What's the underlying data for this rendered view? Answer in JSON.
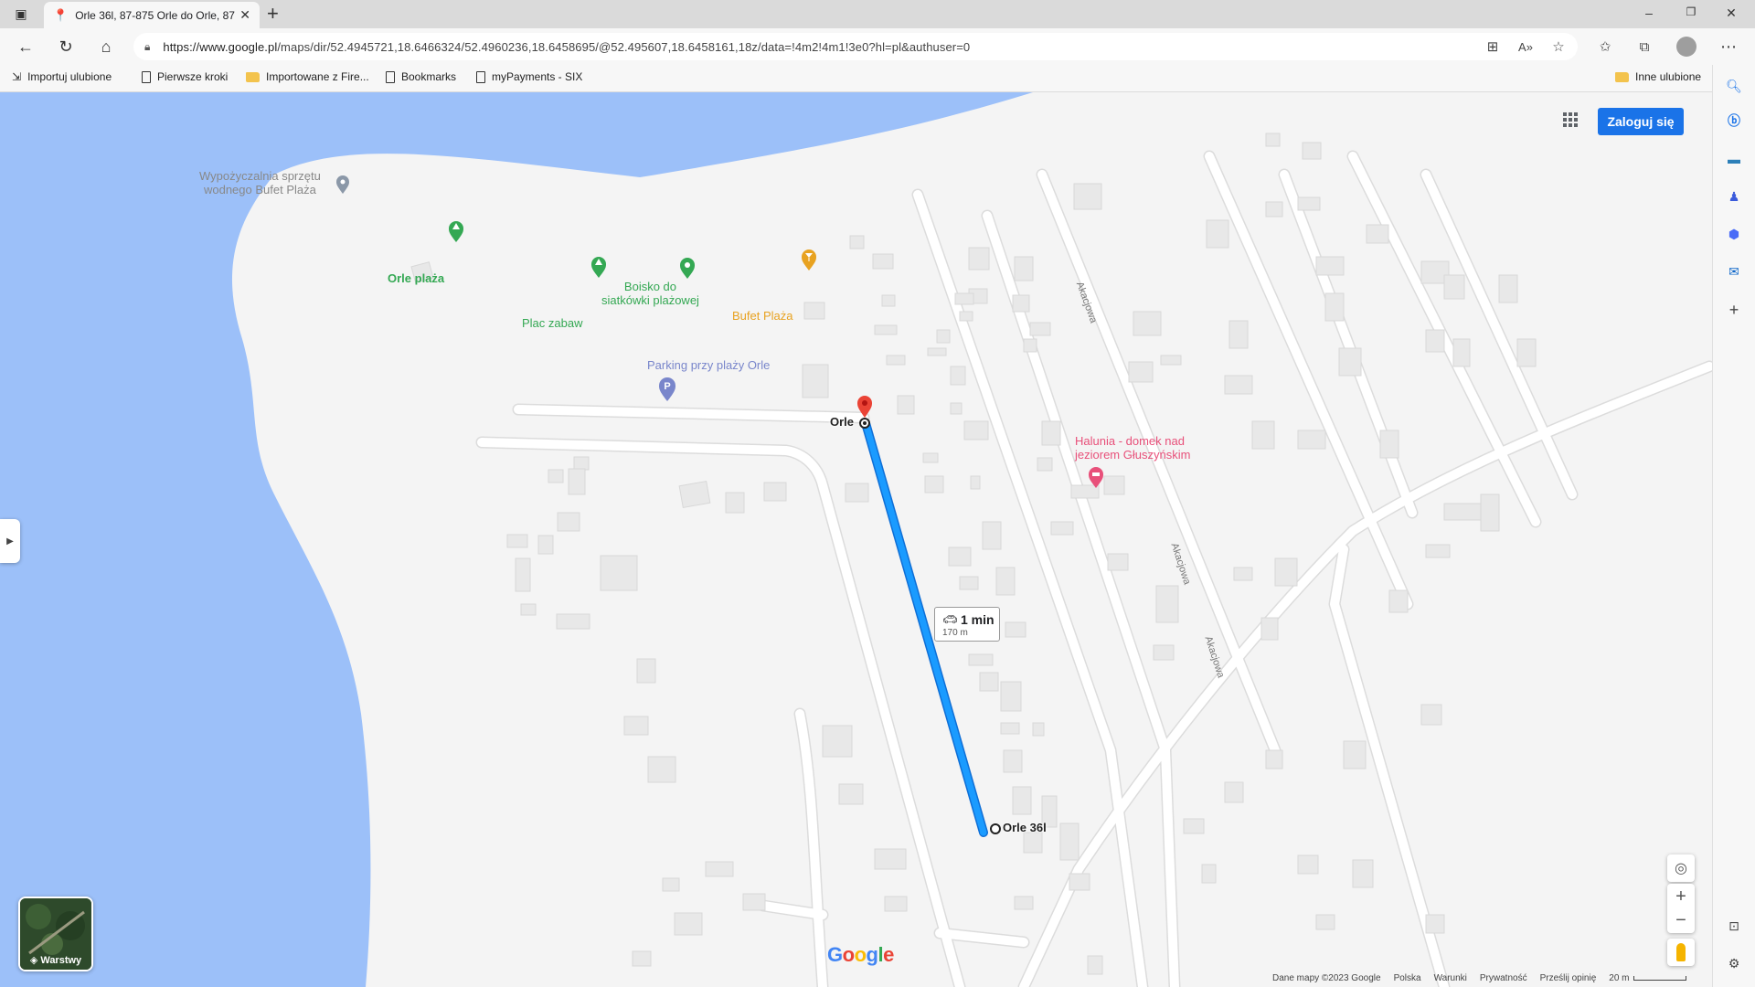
{
  "browser": {
    "tab_title": "Orle 36l, 87-875 Orle do Orle, 87",
    "url_host": "https://www.google.pl",
    "url_path": "/maps/dir/52.4945721,18.6466324/52.4960236,18.6458695/@52.495607,18.6458161,18z/data=!4m2!4m1!3e0?hl=pl&authuser=0"
  },
  "favorites": {
    "items": [
      "Importuj ulubione",
      "Pierwsze kroki",
      "Importowane z Fire...",
      "Bookmarks",
      "myPayments - SIX"
    ],
    "other": "Inne ulubione"
  },
  "map": {
    "signin_label": "Zaloguj się",
    "layers_label": "Warstwy",
    "pois": {
      "rental": "Wypożyczalnia sprzętu\nwodnego Bufet Plaża",
      "orle_plaza": "Orle plaża",
      "volleyball": "Boisko do\nsiatkówki plażowej",
      "playground": "Plac zabaw",
      "bufet": "Bufet Plaża",
      "parking": "Parking przy plaży Orle",
      "halunia": "Halunia - domek nad\njeziorem Głuszyńskim"
    },
    "roads": [
      "Akacjowa",
      "Akacjowa",
      "Akacjowa"
    ],
    "route": {
      "start_label": "Orle",
      "end_label": "Orle 36l",
      "time": "1 min",
      "distance": "170 m"
    },
    "google_logo": "Google",
    "footer": [
      "Dane mapy ©2023 Google",
      "Polska",
      "Warunki",
      "Prywatność",
      "Prześlij opinię"
    ],
    "scale": "20 m"
  },
  "colors": {
    "water": "#9cc0f9",
    "land": "#f4f4f4",
    "route": "#1a8cff",
    "poi_green": "#34a853",
    "poi_orange": "#e8a220",
    "poi_blue": "#7986cb",
    "poi_pink": "#e8507a",
    "pin_red": "#ea4335",
    "signin_blue": "#1a73e8"
  }
}
